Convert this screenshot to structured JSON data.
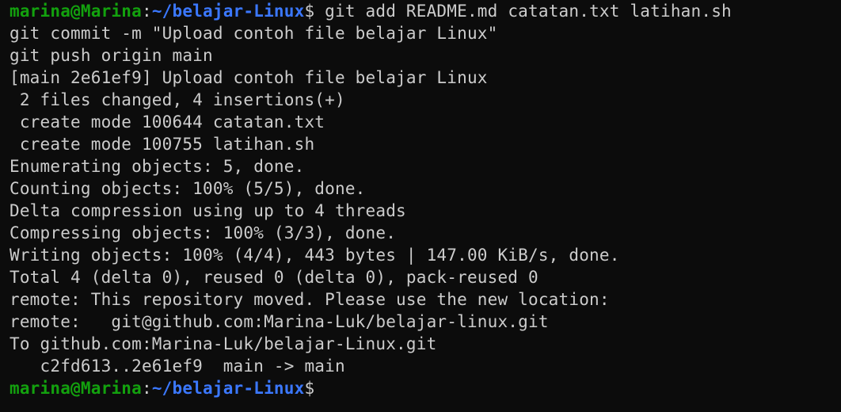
{
  "colors": {
    "background": "#0c0c0c",
    "foreground": "#cccccc",
    "user_host": "#13a10e",
    "path": "#3b78ff"
  },
  "prompt": {
    "user_host": "marina@Marina",
    "separator": ":",
    "path": "~/belajar-Linux",
    "symbol": "$"
  },
  "session": {
    "command": " git add README.md catatan.txt latihan.sh",
    "output": [
      "git commit -m \"Upload contoh file belajar Linux\"",
      "git push origin main",
      "[main 2e61ef9] Upload contoh file belajar Linux",
      " 2 files changed, 4 insertions(+)",
      " create mode 100644 catatan.txt",
      " create mode 100755 latihan.sh",
      "Enumerating objects: 5, done.",
      "Counting objects: 100% (5/5), done.",
      "Delta compression using up to 4 threads",
      "Compressing objects: 100% (3/3), done.",
      "Writing objects: 100% (4/4), 443 bytes | 147.00 KiB/s, done.",
      "Total 4 (delta 0), reused 0 (delta 0), pack-reused 0",
      "remote: This repository moved. Please use the new location:",
      "remote:   git@github.com:Marina-Luk/belajar-linux.git",
      "To github.com:Marina-Luk/belajar-Linux.git",
      "   c2fd613..2e61ef9  main -> main"
    ]
  }
}
